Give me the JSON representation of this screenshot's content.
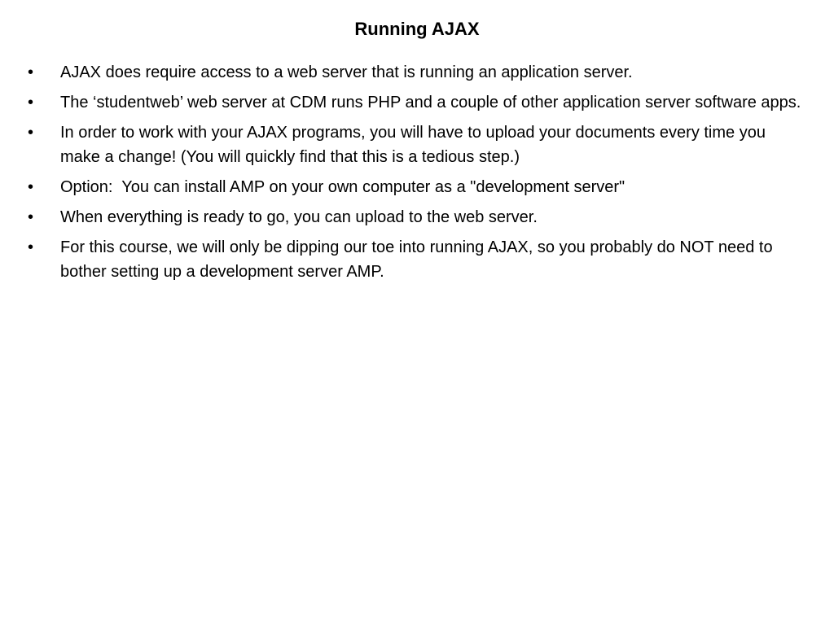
{
  "slide": {
    "title": "Running AJAX",
    "bullet_symbol": "•",
    "bullets": [
      "AJAX does require access to a web server that is running an application server.",
      "The ‘studentweb’ web server at CDM runs PHP and a couple of other application server software apps.",
      "In order to work with your AJAX programs, you will have to upload your documents every time you make a change! (You will quickly find that this is a tedious step.)",
      "Option:  You can install AMP on your own computer as a \"development server\"",
      "When everything is ready to go, you can upload to the web server.",
      "For this course, we will only be dipping our toe into running AJAX, so you probably do NOT need to bother setting up a development server AMP."
    ]
  }
}
